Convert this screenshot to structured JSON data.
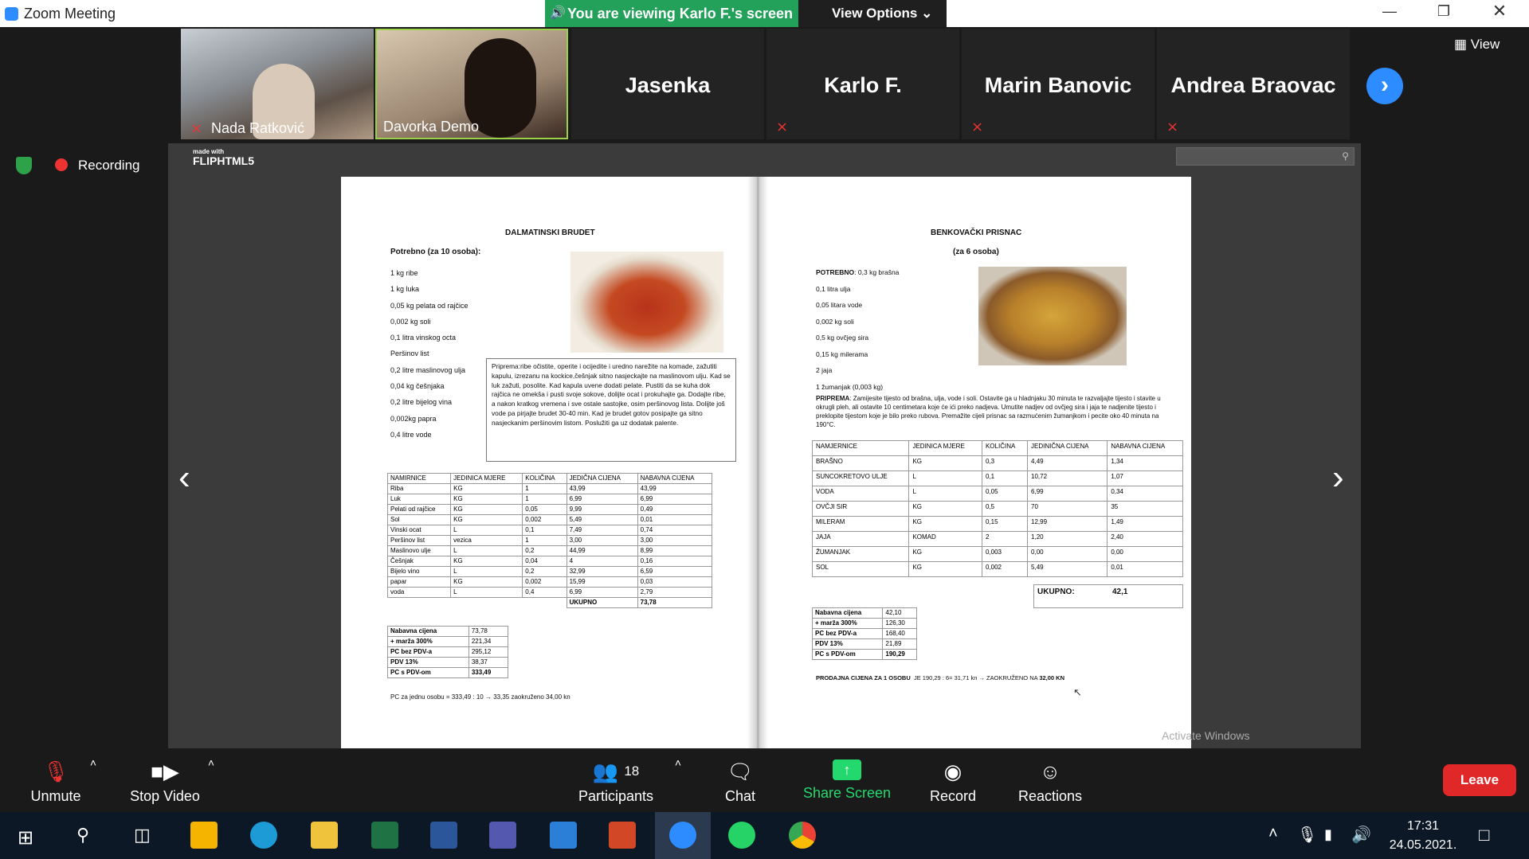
{
  "window": {
    "title": "Zoom Meeting",
    "banner": "You are viewing Karlo F.'s screen",
    "view_options": "View Options ⌄"
  },
  "participants": [
    {
      "name": "Nada Ratković",
      "video": true,
      "muted": true
    },
    {
      "name": "Davorka Demo",
      "video": true,
      "muted": false
    },
    {
      "name": "Jasenka",
      "video": false,
      "muted": false
    },
    {
      "name": "Karlo F.",
      "video": false,
      "muted": true
    },
    {
      "name": "Marin Banovic",
      "video": false,
      "muted": true
    },
    {
      "name": "Andrea Braovac",
      "video": false,
      "muted": true
    }
  ],
  "view_label": "View",
  "recording_label": "Recording",
  "fliphtml5": {
    "made_with": "made with",
    "brand": "FLIPHTML5"
  },
  "left_page": {
    "title": "DALMATINSKI BRUDET",
    "needs": "Potrebno (za 10 osoba):",
    "ingredients": [
      "1 kg ribe",
      "1 kg luka",
      "0,05 kg pelata od rajčice",
      "0,002 kg soli",
      "0,1 litra vinskog octa",
      "Peršinov list",
      "0,2 litre maslinovog ulja",
      "0,04 kg češnjaka",
      "0,2 litre bijelog vina",
      "0,002kg papra",
      "0,4 litre vode"
    ],
    "prep": "Priprema:ribe očistite, operite i ocijedite i uredno narežite na komade, zažutiti kapulu, izrezanu na kockice,češnjak sitno nasjeckajte na maslinovom ulju. Kad se luk zažuti, posolite. Kad kapula uvene dodati pelate. Pustiti da se kuha dok rajčica ne omekša i pusti svoje sokove, dolijte ocat i prokuhajte ga. Dodajte ribe, a nakon kratkog vremena i sve ostale sastojke, osim peršinovog lista. Dolijte još vode pa pirjajte brudet 30-40 min. Kad je brudet gotov posipajte ga sitno nasjeckanim peršinovim listom. Poslužiti ga uz dodatak palente.",
    "table_header": [
      "NAMIRNICE",
      "JEDINICA MJERE",
      "KOLIČINA",
      "JEDIČNA CIJENA",
      "NABAVNA CIJENA"
    ],
    "table_rows": [
      [
        "Riba",
        "KG",
        "1",
        "43,99",
        "43,99"
      ],
      [
        "Luk",
        "KG",
        "1",
        "6,99",
        "6,99"
      ],
      [
        "Pelati od rajčice",
        "KG",
        "0,05",
        "9,99",
        "0,49"
      ],
      [
        "Sol",
        "KG",
        "0,002",
        "5,49",
        "0,01"
      ],
      [
        "Vinski ocat",
        "L",
        "0,1",
        "7,49",
        "0,74"
      ],
      [
        "Peršinov list",
        "vezica",
        "1",
        "3,00",
        "3,00"
      ],
      [
        "Maslinovo ulje",
        "L",
        "0,2",
        "44,99",
        "8,99"
      ],
      [
        "Češnjak",
        "KG",
        "0,04",
        "4",
        "0,16"
      ],
      [
        "Bijelo vino",
        "L",
        "0,2",
        "32,99",
        "6,59"
      ],
      [
        "papar",
        "KG",
        "0,002",
        "15,99",
        "0,03"
      ],
      [
        "voda",
        "L",
        "0,4",
        "6,99",
        "2,79"
      ]
    ],
    "total_label": "UKUPNO",
    "total": "73,78",
    "summary": [
      [
        "Nabavna cijena",
        "73,78"
      ],
      [
        "+ marža 300%",
        "221,34"
      ],
      [
        "PC bez PDV-a",
        "295,12"
      ],
      [
        "PDV 13%",
        "38,37"
      ],
      [
        "PC s PDV-om",
        "333,49"
      ]
    ],
    "per_person": "PC za jednu osobu = 333,49 : 10 → 33,35  zaokruženo 34,00 kn"
  },
  "right_page": {
    "title": "BENKOVAČKI PRISNAC",
    "serves": "(za 6 osoba)",
    "needs_label": "POTREBNO",
    "ingredients": [
      "0,3 kg brašna",
      "0,1 litra ulja",
      "0,05 litara vode",
      "0,002 kg soli",
      "0,5 kg ovčjeg sira",
      "0,15 kg milerama",
      "2 jaja",
      "1 žumanjak (0,003 kg)"
    ],
    "prep_label": "PRIPREMA",
    "prep": "Zamijesite tijesto od brašna, ulja, vode i soli. Ostavite ga u hladnjaku 30 minuta te razvaljajte tijesto i stavite u okrugli pleh, ali ostavite 10 centimetara koje će ići preko nadjeva. Umutite nadjev od ovčjeg sira i jaja te nadjenite tijesto i preklopite tijestom koje je bilo preko rubova. Premažite cijeli prisnac sa razmućenim žumanjkom i pecite oko 40 minuta na 190°C.",
    "table_header": [
      "NAMJERNICE",
      "JEDINICA MJERE",
      "KOLIČINA",
      "JEDINIČNA CIJENA",
      "NABAVNA CIJENA"
    ],
    "table_rows": [
      [
        "BRAŠNO",
        "KG",
        "0,3",
        "4,49",
        "1,34"
      ],
      [
        "SUNCOKRETOVO ULJE",
        "L",
        "0,1",
        "10,72",
        "1,07"
      ],
      [
        "VODA",
        "L",
        "0,05",
        "6,99",
        "0,34"
      ],
      [
        "OVČJI SIR",
        "KG",
        "0,5",
        "70",
        "35"
      ],
      [
        "MILERAM",
        "KG",
        "0,15",
        "12,99",
        "1,49"
      ],
      [
        "JAJA",
        "KOMAD",
        "2",
        "1,20",
        "2,40"
      ],
      [
        "ŽUMANJAK",
        "KG",
        "0,003",
        "0,00",
        "0,00"
      ],
      [
        "SOL",
        "KG",
        "0,002",
        "5,49",
        "0,01"
      ]
    ],
    "total_label": "UKUPNO:",
    "total": "42,1",
    "summary": [
      [
        "Nabavna cijena",
        "42,10"
      ],
      [
        "+ marža 300%",
        "126,30"
      ],
      [
        "PC bez PDV-a",
        "168,40"
      ],
      [
        "PDV 13%",
        "21,89"
      ],
      [
        "PC s PDV-om",
        "190,29"
      ]
    ],
    "sale_label": "PRODAJNA CIJENA ZA 1 OSOBU",
    "sale": "JE 190,29 : 6= 31,71 kn → ZAOKRUŽENO NA",
    "sale_final": "32,00 KN"
  },
  "watermark": "Activate Windows",
  "toolbar": {
    "unmute": "Unmute",
    "stop_video": "Stop Video",
    "participants": "Participants",
    "participants_count": "18",
    "chat": "Chat",
    "share": "Share Screen",
    "record": "Record",
    "reactions": "Reactions",
    "leave": "Leave"
  },
  "clock": {
    "time": "17:31",
    "date": "24.05.2021."
  },
  "colors": {
    "accent": "#2d8cff",
    "share_green": "#23d96e",
    "leave": "#e02828",
    "banner": "#23a05a"
  }
}
